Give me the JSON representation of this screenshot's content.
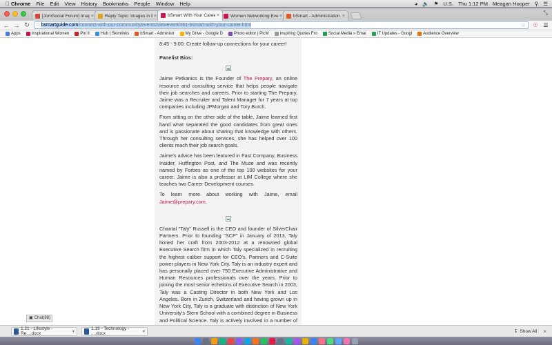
{
  "menubar": {
    "app": "Chrome",
    "items": [
      "File",
      "Edit",
      "View",
      "History",
      "Bookmarks",
      "People",
      "Window",
      "Help"
    ],
    "language": "U.S.",
    "clock": "Thu 1:12 PM",
    "user": "Meagan Hooper"
  },
  "tabs": [
    {
      "title": "[JomSocial Forum] Images",
      "color": "#d44638"
    },
    {
      "title": "Reply Topic: Images in Ev",
      "color": "#e0a020"
    },
    {
      "title": "bSmart With Your Career !",
      "color": "#c4154f",
      "active": true
    },
    {
      "title": "Women Networking Events",
      "color": "#c4154f"
    },
    {
      "title": "bSmart - Administration",
      "color": "#e05a2a"
    }
  ],
  "toolbar": {
    "url_host": "bsmartguide.com",
    "url_path": "/connect-with-our-community/events/viewevent/361-bsmart-with-your-career.html"
  },
  "bookmarks": [
    {
      "label": "Apps",
      "color": "#4a7bd6"
    },
    {
      "label": "Inspirational Women",
      "color": "#c4154f"
    },
    {
      "label": "Pin It",
      "color": "#c8232c"
    },
    {
      "label": "Hub | Skimlinks",
      "color": "#3f8ed8"
    },
    {
      "label": "bSmart - Administr",
      "color": "#e05a2a"
    },
    {
      "label": "My Drive - Google D",
      "color": "#f4b400"
    },
    {
      "label": "Photo editor | PicM",
      "color": "#7a4fb0"
    },
    {
      "label": "Inspiring Quotes Fro",
      "color": "#999999"
    },
    {
      "label": "Social Media » Emai",
      "color": "#2a9d5c"
    },
    {
      "label": "IT Updates - Googl",
      "color": "#2a9d5c"
    },
    {
      "label": "Audience Overview",
      "color": "#e8710a"
    }
  ],
  "content": {
    "schedule_line": "8:45 - 9:00: Create follow-up connections for your career!",
    "bios_heading": "Panelist Bios:",
    "p1_a": "Jaime Petkanics is the Founder of ",
    "p1_link": "The Prepary",
    "p1_b": ", an online resource and consulting service that helps people navigate their job searches and careers. Prior to starting The Prepary, Jaime was a Recruiter and Talent Manager for 7 years at top companies including JPMorgan and Tory Burch.",
    "p2": "From sitting on the other side of the table, Jaime learned first hand what separated the good candidates from great ones and is passionate about sharing that knowledge with others. Through her consulting services, she has helped over 100 clients reach their job search goals.",
    "p3": "Jaime's advice has been featured in Fast Company, Business Insider, Huffington Post, and The Muse and was recently named by Forbes as one of the top 100 websites for your career. Jaime is also a professor at LIM College where she teaches two Career Development courses.",
    "p4_a": "To learn more about working with Jaime, email ",
    "p4_link": "Jaime@prepary.com",
    "p4_b": ".",
    "p5": "Chantal \"Taly\" Russell is the CEO and founder of SilverChair Partners. Prior to founding \"SCP\" in January of 2013, Taly honed her craft from 2003-2012 at a renowned global Executive Search firm in which Taly specialized in recruiting the highest caliber support for CEO's, Partners and C-Suite power players in New York City. Taly is an industry expert and has personally placed over 750 Executive Administrative and Human Resources professionals over the years. Prior to joining the most senior echelons of Executive Search in 2003, Taly was a Casting Director in both New York and Los Angeles. Born in Zurich, Switzerland and having grown up in New York City, Taly is a graduate with distinction of New York University's Stern School with a combined degree in Business and Political Science. Taly is actively involved in a number of different philanthropies and is an active member of the Friends of Duke Rosenthal in New York LGBT. Taly"
  },
  "chat": {
    "label": "Chat(88)"
  },
  "downloads": [
    {
      "name": "1.21 - Lifestyle - Re....docx"
    },
    {
      "name": "1.19 - Technology - ....docx"
    }
  ],
  "shelf": {
    "show_all": "Show All"
  },
  "dock_colors": [
    "#3b82f6",
    "#6b7280",
    "#f59e0b",
    "#10b981",
    "#ef4444",
    "#8b5cf6",
    "#0ea5e9",
    "#f97316",
    "#22c55e",
    "#e11d48",
    "#64748b",
    "#14b8a6",
    "#a855f7",
    "#eab308",
    "#3b82f6",
    "#fb7185",
    "#4ade80",
    "#60a5fa",
    "#f472b6",
    "#94a3b8"
  ]
}
